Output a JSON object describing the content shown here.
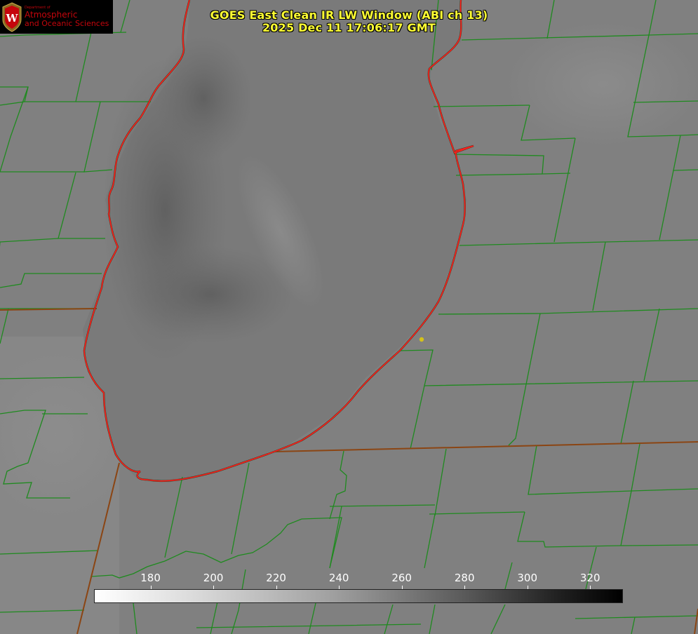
{
  "title": {
    "line1": "GOES East Clean IR LW Window (ABI ch 13)",
    "line2": "2025 Dec 11 17:06:17 GMT"
  },
  "logo": {
    "department": "Department of",
    "line1": "Atmospheric",
    "line2": "and Oceanic Sciences",
    "color": "#c5050c"
  },
  "colorbar": {
    "tick_labels": [
      "180",
      "200",
      "220",
      "240",
      "260",
      "280",
      "300",
      "320"
    ],
    "min": 162,
    "max": 330
  },
  "map": {
    "background_gray": "#808080",
    "county_line_color": "#1f8a1f",
    "state_line_color": "#8b4513",
    "lake_outline_color": "#ff2020",
    "marker_color": "#d4c21a"
  }
}
